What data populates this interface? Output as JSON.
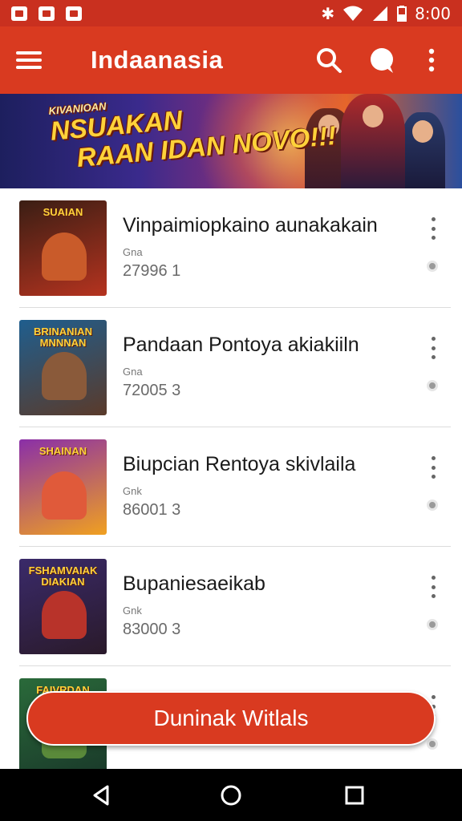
{
  "status_bar": {
    "time": "8:00",
    "icons": [
      "notification-icon",
      "notification-icon",
      "notification-icon",
      "bluetooth-icon",
      "wifi-icon",
      "signal-icon",
      "battery-icon"
    ]
  },
  "app_bar": {
    "title": "Indaanasia",
    "color": "#d93a20",
    "icons": [
      "menu-icon",
      "search-icon",
      "chat-icon",
      "more-vert-icon"
    ]
  },
  "banner": {
    "line1": "KIVANIOAN",
    "line2": "NSUAKAN",
    "line3": "RAAN IDAN NOVO!!!"
  },
  "games": [
    {
      "title": "Vinpaimiopkaino aunakakain",
      "meta": "Gna",
      "count": "27996 1",
      "thumb_label": "SUAIAN",
      "thumb_colors": [
        "#3a1e14",
        "#b5331f"
      ],
      "char_color": "#c95b2a"
    },
    {
      "title": "Pandaan Pontoya akiakiiln",
      "meta": "Gna",
      "count": "72005 3",
      "thumb_label": "BRINANIAN MNNNAN",
      "thumb_colors": [
        "#1f5e8e",
        "#5a3a2a"
      ],
      "char_color": "#8a5a3a"
    },
    {
      "title": "Biupcian Rentoya skivlaila",
      "meta": "Gnk",
      "count": "86001 3",
      "thumb_label": "SHAINAN",
      "thumb_colors": [
        "#8a2fa8",
        "#f0a020"
      ],
      "char_color": "#e05a3a"
    },
    {
      "title": "Bupaniesaeikab",
      "meta": "Gnk",
      "count": "83000 3",
      "thumb_label": "FSHAMVAIAK DIAKIAN",
      "thumb_colors": [
        "#3a2a6a",
        "#2a1a2a"
      ],
      "char_color": "#b8332a"
    },
    {
      "title": "",
      "meta": "",
      "count": "",
      "thumb_label": "FAIVRDAN",
      "thumb_colors": [
        "#2a6a3a",
        "#1a3a2a"
      ],
      "char_color": "#5a8a3a"
    }
  ],
  "cta": {
    "label": "Duninak Witlals"
  },
  "nav_bar": {
    "icons": [
      "back-icon",
      "home-icon",
      "recents-icon"
    ]
  }
}
